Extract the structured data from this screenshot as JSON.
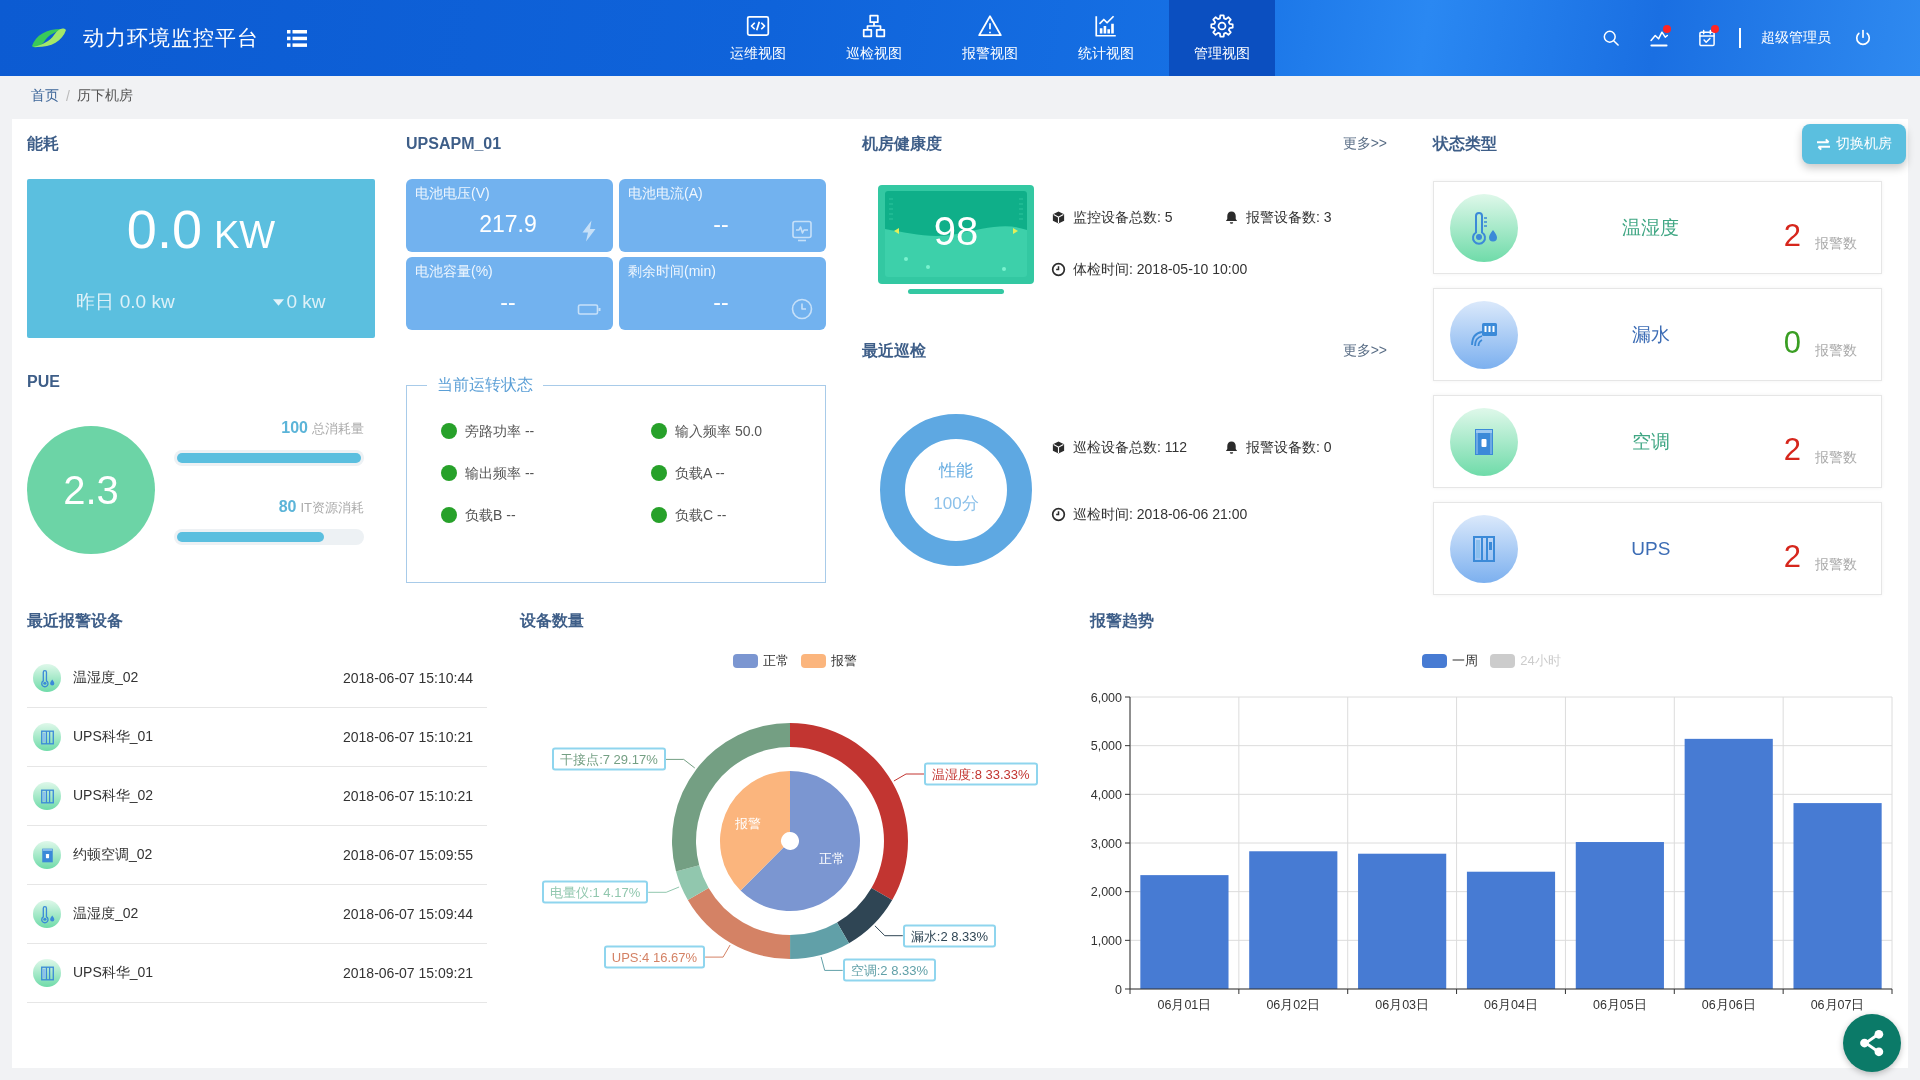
{
  "header": {
    "title": "动力环境监控平台",
    "nav": [
      {
        "label": "运维视图",
        "kind": "code",
        "selected": false
      },
      {
        "label": "巡检视图",
        "kind": "sitemap",
        "selected": false
      },
      {
        "label": "报警视图",
        "kind": "warning",
        "selected": false
      },
      {
        "label": "统计视图",
        "kind": "chart",
        "selected": false
      },
      {
        "label": "管理视图",
        "kind": "gear",
        "selected": true
      }
    ],
    "tools": [
      {
        "kind": "search",
        "dot": false
      },
      {
        "kind": "activity",
        "dot": true
      },
      {
        "kind": "calendar",
        "dot": true
      }
    ],
    "user": "超级管理员"
  },
  "breadcrumb": {
    "separator": "/",
    "items": [
      {
        "label": "首页",
        "current": false
      },
      {
        "label": "历下机房",
        "current": true
      }
    ]
  },
  "energy": {
    "title": "能耗",
    "value": "0.0",
    "unit": "KW",
    "yesterday": "昨日 0.0 kw",
    "decreasing": true,
    "change": "0 kw"
  },
  "pue": {
    "title": "PUE",
    "value": "2.3",
    "bars": [
      {
        "value": "100",
        "label": "总消耗量",
        "level": 1
      },
      {
        "value": "80",
        "label": "IT资源消耗",
        "level": 0.8
      }
    ]
  },
  "ups": {
    "title": "UPSAPM_01",
    "tiles": [
      {
        "label": "电池电压(V)",
        "value": "217.9",
        "kind": "bolt"
      },
      {
        "label": "电池电流(A)",
        "value": "--",
        "kind": "monitor"
      },
      {
        "label": "电池容量(%)",
        "value": "--",
        "kind": "battery"
      },
      {
        "label": "剩余时间(min)",
        "value": "--",
        "kind": "clock"
      }
    ],
    "status": {
      "legend": "当前运转状态",
      "items": [
        "旁路功率 --",
        "输入频率 50.0",
        "输出频率 --",
        "负载A --",
        "负载B --",
        "负载C --"
      ]
    }
  },
  "health": {
    "title": "机房健康度",
    "more": "更多>>",
    "score": "98",
    "stats": [
      {
        "kind": "device",
        "text": "监控设备总数: 5"
      },
      {
        "kind": "alarm",
        "text": "报警设备数: 3"
      },
      {
        "kind": "time",
        "text": "体检时间: 2018-05-10 10:00"
      }
    ]
  },
  "inspection": {
    "title": "最近巡检",
    "more": "更多>>",
    "ring_label": "性能",
    "ring_score": "100分",
    "stats": [
      {
        "kind": "device",
        "text": "巡检设备总数: 112"
      },
      {
        "kind": "alarm",
        "text": "报警设备数: 0"
      },
      {
        "kind": "time",
        "text": "巡检时间: 2018-06-06 21:00"
      }
    ]
  },
  "status_types": {
    "title": "状态类型",
    "switch_button": "切换机房",
    "cards": [
      {
        "kind": "temperature",
        "name": "温湿度",
        "color": "#3fa683",
        "count": "2",
        "count_label": "报警数",
        "alarm": true
      },
      {
        "kind": "water",
        "name": "漏水",
        "color": "#3d6db5",
        "count": "0",
        "count_label": "报警数",
        "alarm": false
      },
      {
        "kind": "aircon",
        "name": "空调",
        "color": "#3fa683",
        "count": "2",
        "count_label": "报警数",
        "alarm": true
      },
      {
        "kind": "ups",
        "name": "UPS",
        "color": "#3d6db5",
        "count": "2",
        "count_label": "报警数",
        "alarm": true
      }
    ]
  },
  "recent_alarms": {
    "title": "最近报警设备",
    "rows": [
      {
        "kind": "temperature",
        "name": "温湿度_02",
        "time": "2018-06-07 15:10:44"
      },
      {
        "kind": "ups",
        "name": "UPS科华_01",
        "time": "2018-06-07 15:10:21"
      },
      {
        "kind": "ups",
        "name": "UPS科华_02",
        "time": "2018-06-07 15:10:21"
      },
      {
        "kind": "aircon",
        "name": "约顿空调_02",
        "time": "2018-06-07 15:09:55"
      },
      {
        "kind": "temperature",
        "name": "温湿度_02",
        "time": "2018-06-07 15:09:44"
      },
      {
        "kind": "ups",
        "name": "UPS科华_01",
        "time": "2018-06-07 15:09:21"
      }
    ]
  },
  "device_count": {
    "title": "设备数量",
    "legend": [
      {
        "label": "正常",
        "color": "#7b96d1"
      },
      {
        "label": "报警",
        "color": "#fbb57d"
      }
    ],
    "pie_slices": [
      {
        "label": "正常"
      },
      {
        "label": "报警"
      }
    ],
    "chart_data": {
      "type": "donut",
      "series": [
        {
          "values": [
            33.33,
            8.33,
            8.33,
            16.67,
            4.17,
            29.17
          ],
          "colors": [
            "#c23531",
            "#2f4554",
            "#61a0a8",
            "#d48265",
            "#91c7ae",
            "#749f83"
          ]
        },
        {
          "values": [
            62.5,
            37.5
          ],
          "colors": [
            "#7b96d1",
            "#fbb57d"
          ]
        }
      ],
      "value_labels": [
        "温湿度:8  33.33%",
        "漏水:2  8.33%",
        "空调:2  8.33%",
        "UPS:4  16.67%",
        "电量仪:1  4.17%",
        "干接点:7  29.17%"
      ]
    }
  },
  "alarm_trend": {
    "title": "报警趋势",
    "legend": [
      {
        "label": "一周",
        "selected": true
      },
      {
        "label": "24小时",
        "selected": false
      }
    ],
    "chart_data": {
      "type": "bar",
      "grid": true,
      "categories": [
        "06月01日",
        "06月02日",
        "06月03日",
        "06月04日",
        "06月05日",
        "06月06日",
        "06月07日"
      ],
      "series": [
        {
          "color": "#477bd3",
          "values": [
            2340,
            2830,
            2780,
            2410,
            3020,
            5140,
            3820
          ]
        }
      ],
      "ylim": [
        0,
        6000
      ],
      "yticks": [
        {
          "value": 0,
          "label": "0"
        },
        {
          "value": 1000,
          "label": "1,000"
        },
        {
          "value": 2000,
          "label": "2,000"
        },
        {
          "value": 3000,
          "label": "3,000"
        },
        {
          "value": 4000,
          "label": "4,000"
        },
        {
          "value": 5000,
          "label": "5,000"
        },
        {
          "value": 6000,
          "label": "6,000"
        }
      ]
    }
  }
}
